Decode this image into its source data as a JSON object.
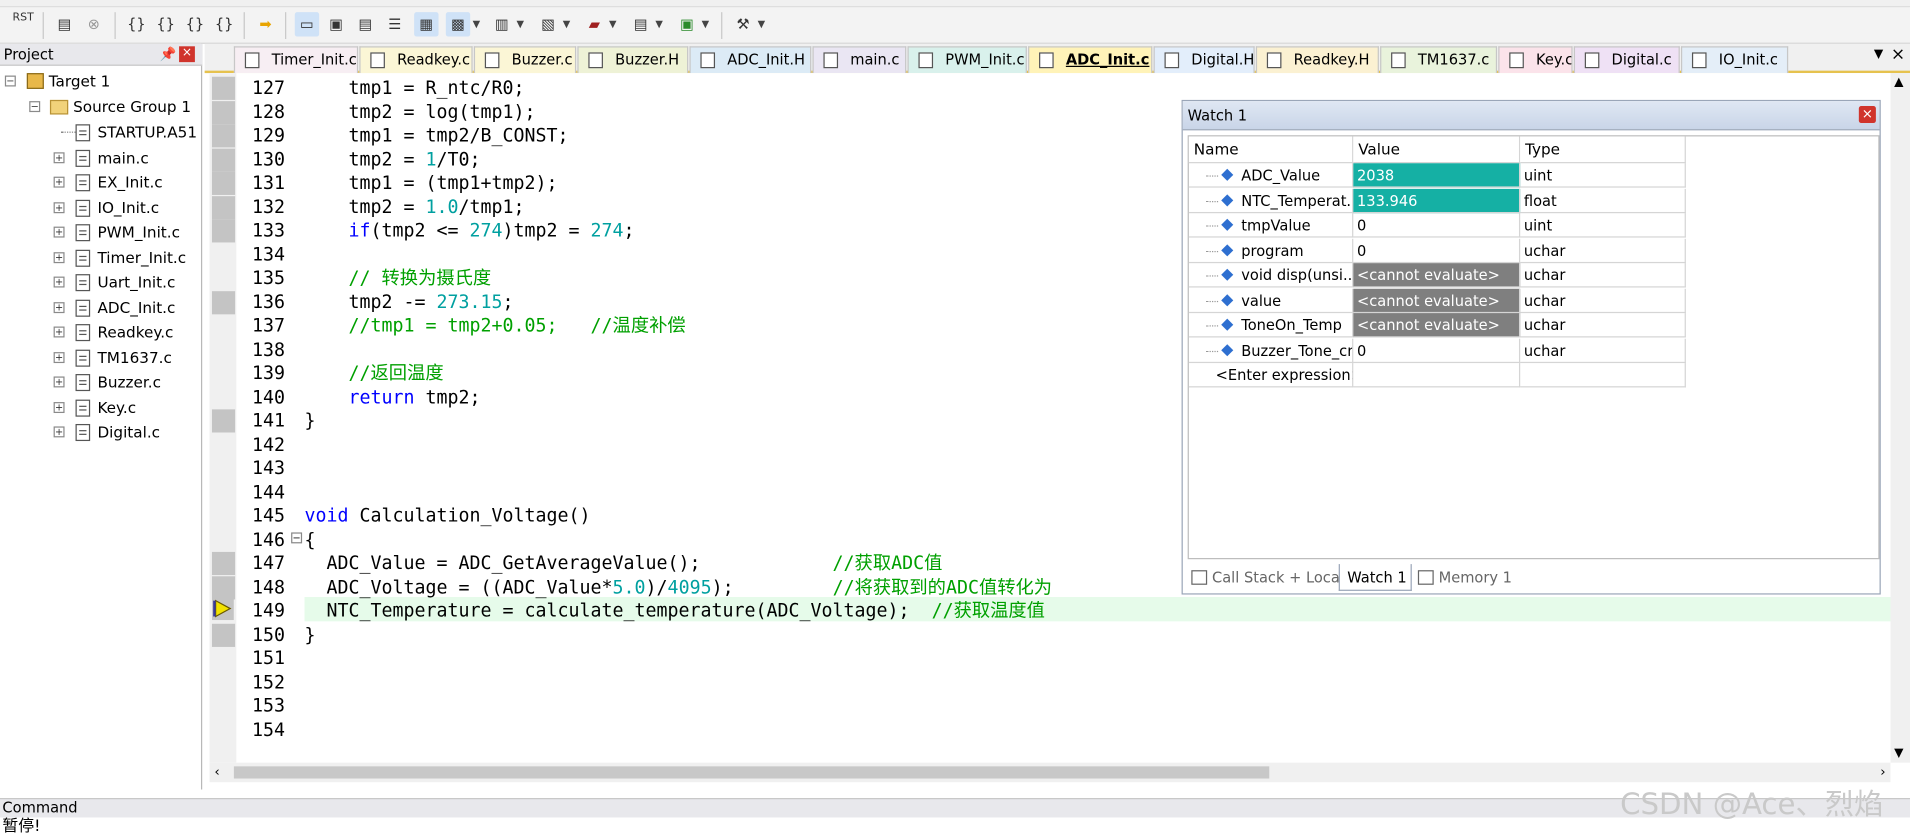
{
  "toolbar": {
    "rst_label": "RST"
  },
  "project": {
    "title": "Project",
    "target": "Target 1",
    "group": "Source Group 1",
    "files": [
      "STARTUP.A51",
      "main.c",
      "EX_Init.c",
      "IO_Init.c",
      "PWM_Init.c",
      "Timer_Init.c",
      "Uart_Init.c",
      "ADC_Init.c",
      "Readkey.c",
      "TM1637.c",
      "Buzzer.c",
      "Key.c",
      "Digital.c"
    ]
  },
  "tabs": [
    "Timer_Init.c",
    "Readkey.c",
    "Buzzer.c",
    "Buzzer.H",
    "ADC_Init.H",
    "main.c",
    "PWM_Init.c",
    "ADC_Init.c",
    "Digital.H",
    "Readkey.H",
    "TM1637.c",
    "Key.c",
    "Digital.c",
    "IO_Init.c"
  ],
  "active_tab": "ADC_Init.c",
  "editor": {
    "current_line": "149",
    "lines": [
      {
        "n": "127",
        "code": "    tmp1 = R_ntc/R0;"
      },
      {
        "n": "128",
        "code": "    tmp2 = log(tmp1);"
      },
      {
        "n": "129",
        "code": "    tmp1 = tmp2/B_CONST;"
      },
      {
        "n": "130",
        "code": "    tmp2 = 1/T0;"
      },
      {
        "n": "131",
        "code": "    tmp1 = (tmp1+tmp2);"
      },
      {
        "n": "132",
        "code": "    tmp2 = 1.0/tmp1;"
      },
      {
        "n": "133",
        "code": "    if(tmp2 <= 274)tmp2 = 274;"
      },
      {
        "n": "134",
        "code": ""
      },
      {
        "n": "135",
        "code": "    // 转换为摄氏度"
      },
      {
        "n": "136",
        "code": "    tmp2 -= 273.15;"
      },
      {
        "n": "137",
        "code": "    //tmp1 = tmp2+0.05;   //温度补偿"
      },
      {
        "n": "138",
        "code": ""
      },
      {
        "n": "139",
        "code": "    //返回温度"
      },
      {
        "n": "140",
        "code": "    return tmp2;"
      },
      {
        "n": "141",
        "code": "}"
      },
      {
        "n": "142",
        "code": ""
      },
      {
        "n": "143",
        "code": ""
      },
      {
        "n": "144",
        "code": ""
      },
      {
        "n": "145",
        "code": "void Calculation_Voltage()"
      },
      {
        "n": "146",
        "code": "{"
      },
      {
        "n": "147",
        "code": "  ADC_Value = ADC_GetAverageValue();            //获取ADC值"
      },
      {
        "n": "148",
        "code": "  ADC_Voltage = ((ADC_Value*5.0)/4095);         //将获取到的ADC值转化为"
      },
      {
        "n": "149",
        "code": "  NTC_Temperature = calculate_temperature(ADC_Voltage);  //获取温度值"
      },
      {
        "n": "150",
        "code": "}"
      },
      {
        "n": "151",
        "code": ""
      },
      {
        "n": "152",
        "code": ""
      },
      {
        "n": "153",
        "code": ""
      },
      {
        "n": "154",
        "code": ""
      }
    ]
  },
  "watch": {
    "title": "Watch 1",
    "headers": [
      "Name",
      "Value",
      "Type"
    ],
    "rows": [
      {
        "name": "ADC_Value",
        "value": "2038",
        "type": "uint",
        "hl": "changed"
      },
      {
        "name": "NTC_Temperat...",
        "value": "133.946",
        "type": "float",
        "hl": "changed"
      },
      {
        "name": "tmpValue",
        "value": "0",
        "type": "uint",
        "hl": ""
      },
      {
        "name": "program",
        "value": "0",
        "type": "uchar",
        "hl": ""
      },
      {
        "name": "void disp(unsi...",
        "value": "<cannot evaluate>",
        "type": "uchar",
        "hl": "error"
      },
      {
        "name": "value",
        "value": "<cannot evaluate>",
        "type": "uchar",
        "hl": "error"
      },
      {
        "name": "ToneOn_Temp",
        "value": "<cannot evaluate>",
        "type": "uchar",
        "hl": "error"
      },
      {
        "name": "Buzzer_Tone_cnt",
        "value": "0",
        "type": "uchar",
        "hl": ""
      }
    ],
    "enter_expression": "<Enter expression>",
    "bottom_tabs": [
      "Call Stack + Locals",
      "Watch 1",
      "Memory 1"
    ],
    "colors": {
      "changed": "#15b0a4",
      "error": "#7f7f7f"
    }
  },
  "command": {
    "title": "Command",
    "output": "暂停!"
  },
  "watermark": "CSDN @Ace、烈焰"
}
